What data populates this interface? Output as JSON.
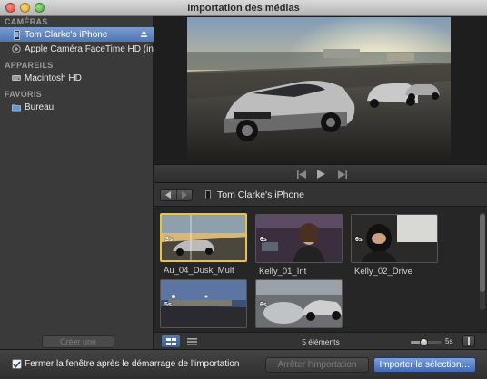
{
  "window": {
    "title": "Importation des médias"
  },
  "sidebar": {
    "sections": [
      {
        "header": "CAMÉRAS",
        "items": [
          {
            "label": "Tom Clarke's iPhone",
            "icon": "iphone-icon",
            "selected": true,
            "eject": true
          },
          {
            "label": "Apple Caméra FaceTime HD (intégrée)",
            "icon": "webcam-icon",
            "selected": false
          }
        ]
      },
      {
        "header": "APPAREILS",
        "items": [
          {
            "label": "Macintosh HD",
            "icon": "hard-drive-icon",
            "selected": false
          }
        ]
      },
      {
        "header": "FAVORIS",
        "items": [
          {
            "label": "Bureau",
            "icon": "desktop-folder-icon",
            "selected": false
          }
        ]
      }
    ],
    "archive_button": "Créer une archive…"
  },
  "transport": {
    "prev_icon": "skip-back-icon",
    "play_icon": "play-icon",
    "next_icon": "skip-forward-icon"
  },
  "browser": {
    "device_name": "Tom Clarke's iPhone",
    "clips": [
      {
        "name": "Au_04_Dusk_Mult",
        "duration": "3s",
        "selected": true
      },
      {
        "name": "Kelly_01_Int",
        "duration": "6s",
        "selected": false
      },
      {
        "name": "Kelly_02_Drive",
        "duration": "6s",
        "selected": false
      },
      {
        "name": "",
        "duration": "5s",
        "selected": false
      },
      {
        "name": "",
        "duration": "6s",
        "selected": false
      }
    ],
    "count": "5 éléments",
    "zoom_value": "5s",
    "zoom_level": 0.4
  },
  "footer": {
    "close_window_checked": true,
    "close_window_label": "Fermer la fenêtre après le démarrage de l'importation",
    "stop_button": "Arrêter l'importation",
    "import_button": "Importer la sélection…"
  },
  "colors": {
    "selection": "#4f76b3",
    "clip_selected_border": "#e6c34a",
    "accent_button": "#3f6bb8"
  }
}
